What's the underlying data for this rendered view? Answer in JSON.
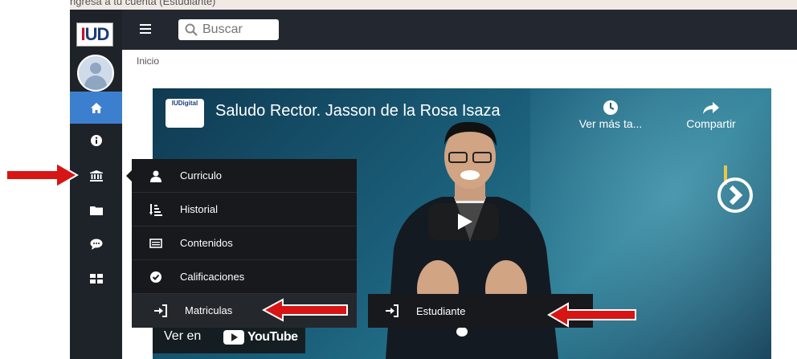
{
  "browser": {
    "tab_strip_text": "ngresa a tu cuenta (Estudiante)"
  },
  "sidebar": {
    "logo": {
      "i": "I",
      "ud": "UD"
    },
    "items": [
      {
        "icon": "home-icon",
        "active": true
      },
      {
        "icon": "info-icon",
        "active": false
      },
      {
        "icon": "institution-icon",
        "active": false
      },
      {
        "icon": "folder-icon",
        "active": false
      },
      {
        "icon": "chat-icon",
        "active": false
      },
      {
        "icon": "grid-icon",
        "active": false
      }
    ]
  },
  "header": {
    "search_placeholder": "Buscar"
  },
  "breadcrumb": {
    "home": "Inicio"
  },
  "flyout_menu": {
    "items": [
      {
        "label": "Curriculo",
        "icon": "user-icon"
      },
      {
        "label": "Historial",
        "icon": "sort-list-icon"
      },
      {
        "label": "Contenidos",
        "icon": "list-box-icon"
      },
      {
        "label": "Calificaciones",
        "icon": "check-circle-icon"
      },
      {
        "label": "Matriculas",
        "icon": "sign-in-icon"
      }
    ]
  },
  "submenu": {
    "label": "Estudiante",
    "icon": "sign-in-icon"
  },
  "video": {
    "title": "Saludo Rector. Jasson de la Rosa Isaza",
    "channel_logo_text": "IUDigital",
    "watch_later": "Ver más ta...",
    "share": "Compartir",
    "watch_on": "Ver en",
    "youtube": "YouTube"
  },
  "colors": {
    "sidebar_bg": "#1e2229",
    "active_item": "#3d7fcf",
    "topbar_bg": "#23272f",
    "flyout_bg": "#17191d",
    "annotation_arrow": "#d71515"
  }
}
